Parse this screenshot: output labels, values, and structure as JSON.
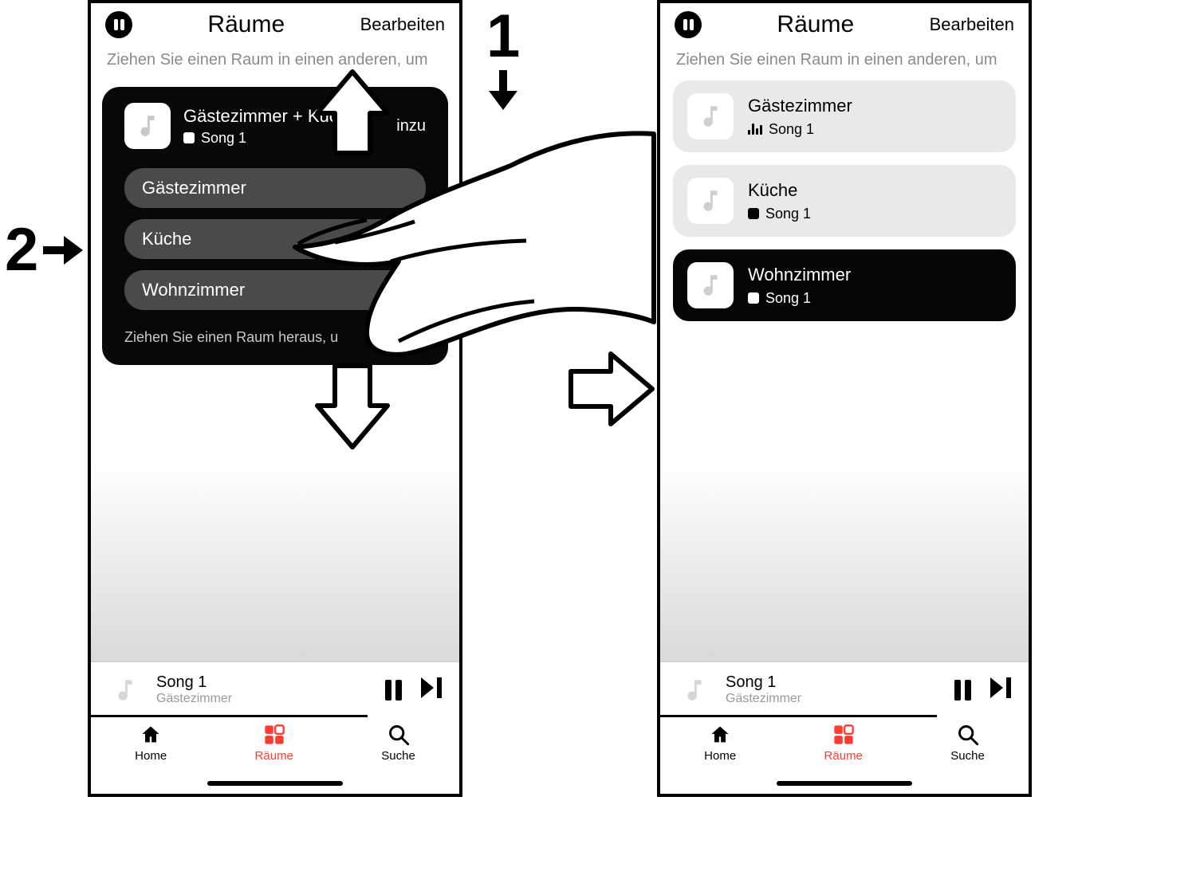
{
  "callouts": {
    "step1": "1",
    "step2": "2"
  },
  "left_phone": {
    "nav": {
      "title": "Räume",
      "edit": "Bearbeiten"
    },
    "hint": "Ziehen Sie einen Raum in einen anderen, um",
    "group": {
      "title": "Gästezimmer + Küche",
      "song": "Song 1",
      "suffix": "inzu",
      "rooms": [
        "Gästezimmer",
        "Küche",
        "Wohnzimmer"
      ],
      "drag_hint": "Ziehen Sie einen Raum heraus, u"
    },
    "nowplaying": {
      "song": "Song 1",
      "room": "Gästezimmer"
    },
    "tabs": {
      "home": "Home",
      "rooms": "Räume",
      "search": "Suche"
    }
  },
  "right_phone": {
    "nav": {
      "title": "Räume",
      "edit": "Bearbeiten"
    },
    "hint": "Ziehen Sie einen Raum in einen anderen, um",
    "rooms": [
      {
        "name": "Gästezimmer",
        "song": "Song 1",
        "status": "playing",
        "dark": false
      },
      {
        "name": "Küche",
        "song": "Song 1",
        "status": "stopped",
        "dark": false
      },
      {
        "name": "Wohnzimmer",
        "song": "Song 1",
        "status": "stopped",
        "dark": true
      }
    ],
    "nowplaying": {
      "song": "Song 1",
      "room": "Gästezimmer"
    },
    "tabs": {
      "home": "Home",
      "rooms": "Räume",
      "search": "Suche"
    }
  },
  "colors": {
    "accent": "#ff3b30"
  }
}
